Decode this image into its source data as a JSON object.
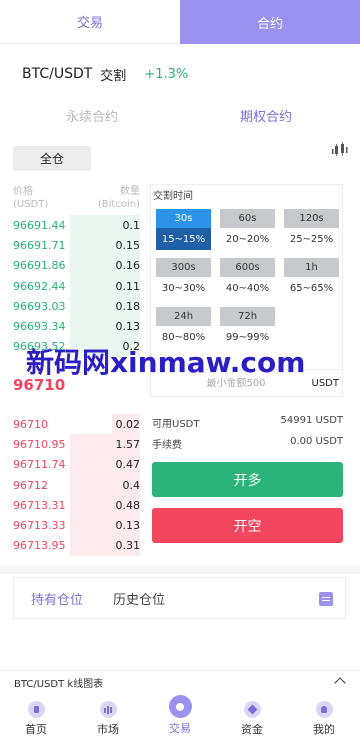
{
  "tabs": {
    "exchange": "交易",
    "contract": "合约"
  },
  "pair": {
    "name": "BTC/USDT",
    "type": "交割",
    "change": "+1.3%"
  },
  "contract_types": {
    "perpetual": "永续合约",
    "options": "期权合约"
  },
  "margin_mode": "全仓",
  "orderbook": {
    "price_header": "价格",
    "price_unit": "(USDT)",
    "qty_header": "数量",
    "qty_unit": "(Bitcoin)",
    "bids": [
      {
        "price": "96691.44",
        "qty": "0.1",
        "depth": 0.55
      },
      {
        "price": "96691.71",
        "qty": "0.15",
        "depth": 0.55
      },
      {
        "price": "96691.86",
        "qty": "0.16",
        "depth": 0.55
      },
      {
        "price": "96692.44",
        "qty": "0.11",
        "depth": 0.55
      },
      {
        "price": "96693.03",
        "qty": "0.18",
        "depth": 0.55
      },
      {
        "price": "96693.34",
        "qty": "0.13",
        "depth": 0.55
      },
      {
        "price": "96693.52",
        "qty": "0.2",
        "depth": 0.55
      }
    ],
    "last_price": "96710",
    "asks": [
      {
        "price": "96710",
        "qty": "0.02",
        "depth": 0.22
      },
      {
        "price": "96710.95",
        "qty": "1.57",
        "depth": 0.55
      },
      {
        "price": "96711.74",
        "qty": "0.47",
        "depth": 0.55
      },
      {
        "price": "96712",
        "qty": "0.4",
        "depth": 0.55
      },
      {
        "price": "96713.31",
        "qty": "0.48",
        "depth": 0.55
      },
      {
        "price": "96713.33",
        "qty": "0.13",
        "depth": 0.55
      },
      {
        "price": "96713.95",
        "qty": "0.31",
        "depth": 0.55
      }
    ]
  },
  "delivery": {
    "title": "交割时间",
    "options": [
      {
        "time": "30s",
        "range": "15~15%",
        "selected": true
      },
      {
        "time": "60s",
        "range": "20~20%",
        "selected": false
      },
      {
        "time": "120s",
        "range": "25~25%",
        "selected": false
      },
      {
        "time": "300s",
        "range": "30~30%",
        "selected": false
      },
      {
        "time": "600s",
        "range": "40~40%",
        "selected": false
      },
      {
        "time": "1h",
        "range": "65~65%",
        "selected": false
      },
      {
        "time": "24h",
        "range": "80~80%",
        "selected": false
      },
      {
        "time": "72h",
        "range": "99~99%",
        "selected": false
      }
    ]
  },
  "amount": {
    "placeholder": "最小金额500",
    "unit": "USDT"
  },
  "available": {
    "label": "可用USDT",
    "value": "54991 USDT"
  },
  "fee": {
    "label": "手续费",
    "value": "0.00 USDT"
  },
  "actions": {
    "long": "开多",
    "short": "开空"
  },
  "positions": {
    "current": "持有仓位",
    "history": "历史仓位"
  },
  "kline_label": "BTC/USDT k线图表",
  "nav": [
    {
      "label": "首页",
      "icon": "home-icon"
    },
    {
      "label": "市场",
      "icon": "market-icon"
    },
    {
      "label": "交易",
      "icon": "trade-icon",
      "active": true
    },
    {
      "label": "资金",
      "icon": "assets-icon"
    },
    {
      "label": "我的",
      "icon": "profile-icon"
    }
  ],
  "watermark": "新码网xinmaw.com",
  "colors": {
    "accent": "#9a92ee",
    "up": "#2bb37a",
    "down": "#f2455e",
    "selected_blue": "#2c93ea"
  }
}
